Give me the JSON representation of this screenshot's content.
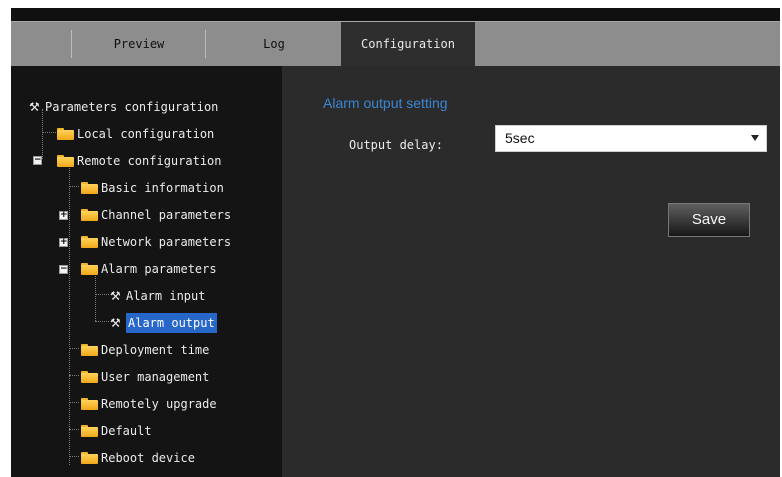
{
  "tabs": {
    "preview": "Preview",
    "log": "Log",
    "configuration": "Configuration",
    "active": "configuration"
  },
  "tree": {
    "root": "Parameters configuration",
    "local": "Local configuration",
    "remote": "Remote configuration",
    "basic_information": "Basic information",
    "channel_parameters": "Channel parameters",
    "network_parameters": "Network parameters",
    "alarm_parameters": "Alarm parameters",
    "alarm_input": "Alarm input",
    "alarm_output": "Alarm output",
    "deployment_time": "Deployment time",
    "user_management": "User management",
    "remotely_upgrade": "Remotely upgrade",
    "default": "Default",
    "reboot_device": "Reboot device",
    "selected": "alarm_output"
  },
  "main": {
    "section_title": "Alarm output setting",
    "output_delay_label": "Output delay:",
    "output_delay_value": "5sec",
    "save_label": "Save"
  },
  "colors": {
    "accent": "#3a86d6",
    "selection": "#2767c9",
    "folder": "#f0b52a"
  },
  "icons": {
    "folder": "folder-icon",
    "wrench": "wrench-icon",
    "expand": "plus-box-icon",
    "collapse": "minus-box-icon",
    "dropdown": "chevron-down-icon"
  }
}
